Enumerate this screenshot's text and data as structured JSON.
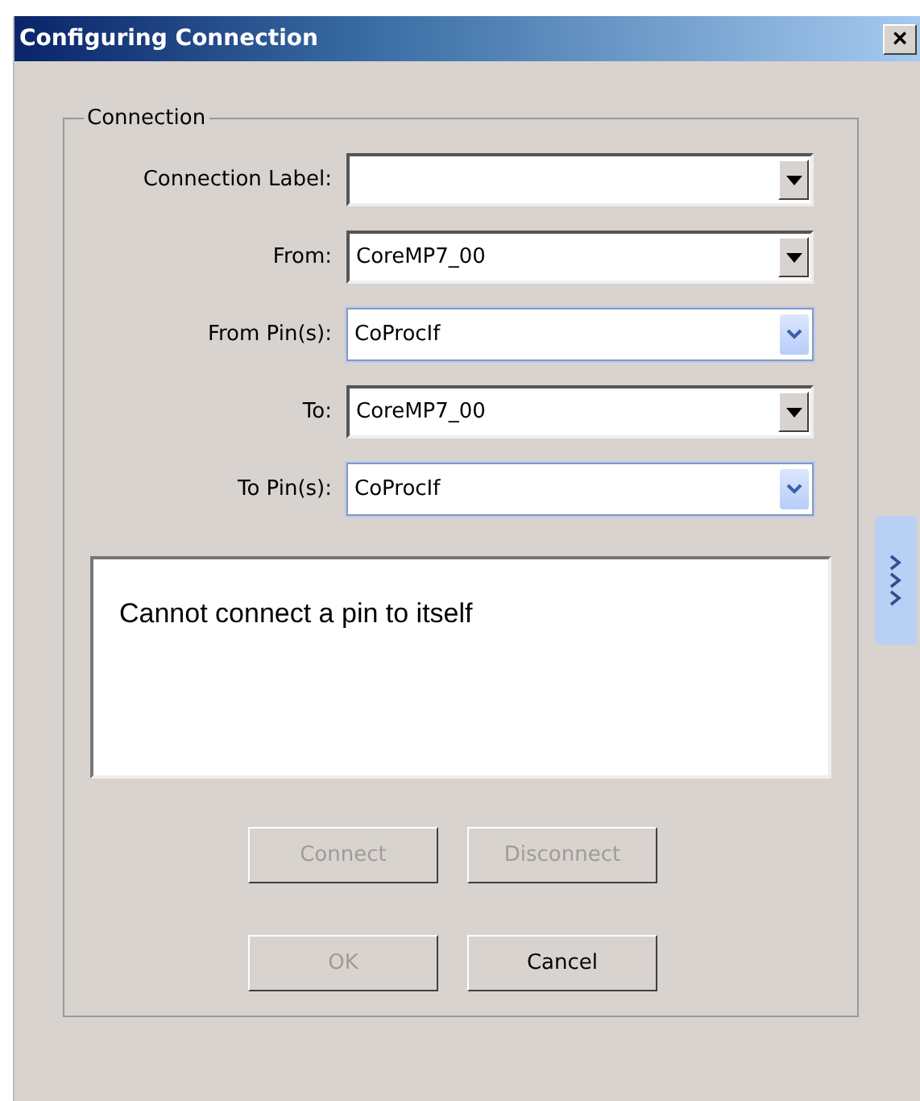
{
  "window": {
    "title": "Configuring Connection",
    "close": "×"
  },
  "group": {
    "title": "Connection"
  },
  "fields": [
    {
      "label": "Connection Label:",
      "kind": "classic"
    },
    {
      "label": "From:",
      "value": "CoreMP7_00",
      "kind": "classic"
    },
    {
      "label": "From Pin(s):",
      "value": "CoProcIf",
      "kind": "styled"
    },
    {
      "label": "To:",
      "value": "CoreMP7_00",
      "kind": "classic"
    },
    {
      "label": "To Pin(s):",
      "value": "CoProcIf",
      "kind": "styled"
    }
  ],
  "message": "Cannot connect a pin to itself",
  "action_buttons": [
    {
      "label": "Connect",
      "disabled": true
    },
    {
      "label": "Disconnect",
      "disabled": true
    }
  ],
  "dialog_buttons": [
    {
      "label": "OK",
      "disabled": true
    },
    {
      "label": "Cancel",
      "disabled": false
    }
  ]
}
